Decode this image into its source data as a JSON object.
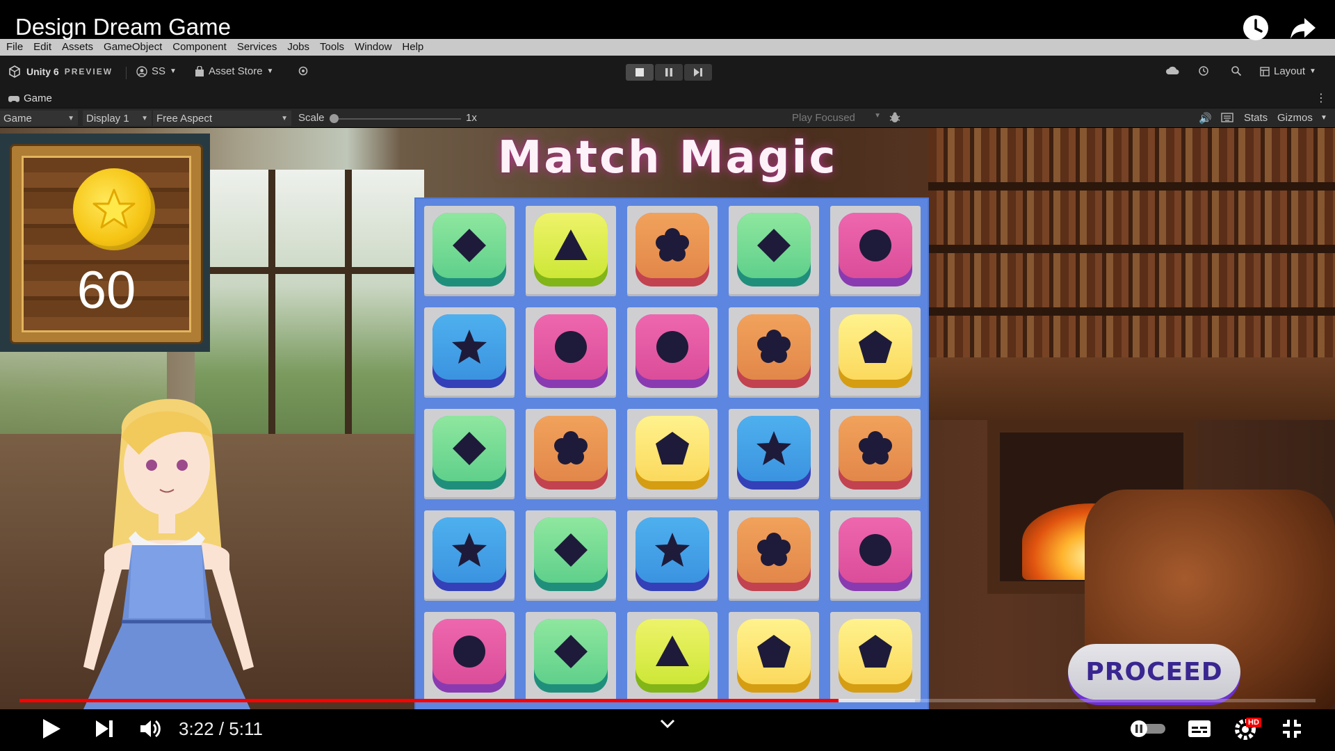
{
  "video": {
    "title": "Design Dream Game",
    "time": "3:22 / 5:11",
    "progress_fraction": 0.632,
    "buffered_fraction": 0.59,
    "hd_badge": "HD",
    "icons": [
      "clock-icon",
      "share-icon",
      "play-icon",
      "next-icon",
      "volume-icon",
      "chevron-down-icon",
      "autoplay-toggle",
      "captions-icon",
      "settings-icon",
      "exit-fullscreen-icon"
    ]
  },
  "menubar": {
    "items": [
      "File",
      "Edit",
      "Assets",
      "GameObject",
      "Component",
      "Services",
      "Jobs",
      "Tools",
      "Window",
      "Help"
    ]
  },
  "toolbar": {
    "brand": "Unity 6",
    "edition": "PREVIEW",
    "account": "SS",
    "asset_store": "Asset Store",
    "layout": "Layout"
  },
  "game_tab": {
    "label": "Game"
  },
  "game_controls": {
    "mode": "Game",
    "display": "Display 1",
    "aspect": "Free Aspect",
    "scale_label": "Scale",
    "scale_value": "1x",
    "play_focused": "Play Focused",
    "stats": "Stats",
    "gizmos": "Gizmos"
  },
  "game": {
    "title": "Match Magic",
    "coins": "60",
    "proceed_label": "PROCEED",
    "board": [
      [
        {
          "color": "green",
          "shape": "diamond"
        },
        {
          "color": "lime",
          "shape": "triangle"
        },
        {
          "color": "orange",
          "shape": "flower"
        },
        {
          "color": "green",
          "shape": "diamond"
        },
        {
          "color": "pink",
          "shape": "circle"
        }
      ],
      [
        {
          "color": "blue",
          "shape": "star"
        },
        {
          "color": "pink",
          "shape": "circle"
        },
        {
          "color": "pink",
          "shape": "circle"
        },
        {
          "color": "orange",
          "shape": "flower"
        },
        {
          "color": "yellow",
          "shape": "pentagon"
        }
      ],
      [
        {
          "color": "green",
          "shape": "diamond"
        },
        {
          "color": "orange",
          "shape": "flower"
        },
        {
          "color": "yellow",
          "shape": "pentagon"
        },
        {
          "color": "blue",
          "shape": "star"
        },
        {
          "color": "orange",
          "shape": "flower"
        }
      ],
      [
        {
          "color": "blue",
          "shape": "star"
        },
        {
          "color": "green",
          "shape": "diamond"
        },
        {
          "color": "blue",
          "shape": "star"
        },
        {
          "color": "orange",
          "shape": "flower"
        },
        {
          "color": "pink",
          "shape": "circle"
        }
      ],
      [
        {
          "color": "pink",
          "shape": "circle"
        },
        {
          "color": "green",
          "shape": "diamond"
        },
        {
          "color": "lime",
          "shape": "triangle"
        },
        {
          "color": "yellow",
          "shape": "pentagon"
        },
        {
          "color": "yellow",
          "shape": "pentagon"
        }
      ]
    ]
  },
  "colors": {
    "board_bg": "#5c86e0",
    "progress": "#ff0000",
    "title_glow": "#b43c8c",
    "proceed_text": "#3a2690"
  }
}
